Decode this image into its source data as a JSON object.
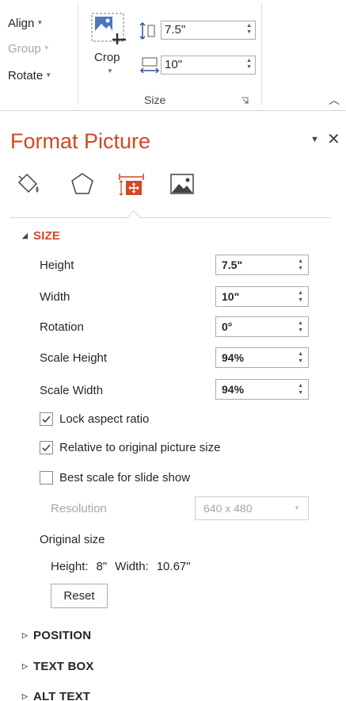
{
  "ribbon": {
    "arrange": {
      "align_label": "Align",
      "group_label": "Group",
      "rotate_label": "Rotate"
    },
    "crop_label": "Crop",
    "height_value": "7.5\"",
    "width_value": "10\"",
    "group_name": "Size"
  },
  "pane": {
    "title": "Format Picture",
    "tabs": [
      {
        "name": "fill-line",
        "icon": "paint-bucket-icon"
      },
      {
        "name": "effects",
        "icon": "pentagon-icon"
      },
      {
        "name": "size-properties",
        "icon": "size-properties-icon",
        "selected": true
      },
      {
        "name": "picture",
        "icon": "picture-icon"
      }
    ],
    "size_section": {
      "title": "SIZE",
      "height_label": "Height",
      "height_value": "7.5\"",
      "width_label": "Width",
      "width_value": "10\"",
      "rotation_label": "Rotation",
      "rotation_value": "0°",
      "scale_height_label": "Scale Height",
      "scale_height_value": "94%",
      "scale_width_label": "Scale Width",
      "scale_width_value": "94%",
      "lock_aspect_label": "Lock aspect ratio",
      "lock_aspect_checked": true,
      "relative_label": "Relative to original picture size",
      "relative_checked": true,
      "best_scale_label": "Best scale for slide show",
      "best_scale_checked": false,
      "resolution_label": "Resolution",
      "resolution_value": "640 x 480",
      "original_size_label": "Original size",
      "orig_height_label": "Height:",
      "orig_height_value": "8\"",
      "orig_width_label": "Width:",
      "orig_width_value": "10.67\"",
      "reset_label": "Reset"
    },
    "collapsed_sections": [
      "POSITION",
      "TEXT BOX",
      "ALT TEXT"
    ]
  },
  "colors": {
    "accent": "#d24726",
    "text": "#262626",
    "disabled": "#a6a6a6"
  }
}
